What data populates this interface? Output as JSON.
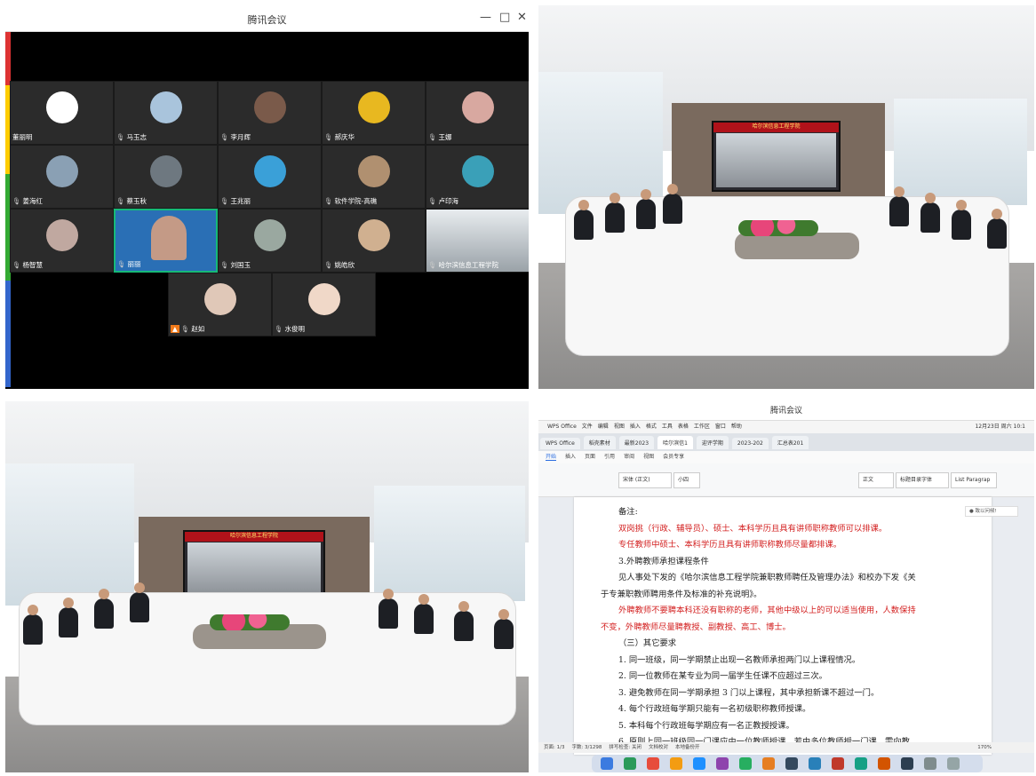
{
  "meeting": {
    "title": "腾讯会议",
    "controls": {
      "minimize": "—",
      "maximize": "□",
      "close": "✕"
    },
    "participants": [
      {
        "name": "董丽明",
        "mic": false,
        "avatar_color": "#ffffff"
      },
      {
        "name": "马玉志",
        "mic": true,
        "avatar_color": "#a9c4dc"
      },
      {
        "name": "李月辉",
        "mic": true,
        "avatar_color": "#7a5a4a"
      },
      {
        "name": "郝庆华",
        "mic": true,
        "avatar_color": "#e8b820"
      },
      {
        "name": "王娜",
        "mic": true,
        "avatar_color": "#d8a8a0"
      },
      {
        "name": "姜海红",
        "mic": true,
        "avatar_color": "#8aa0b4"
      },
      {
        "name": "蔡玉秋",
        "mic": true,
        "avatar_color": "#6e7880"
      },
      {
        "name": "王兆丽",
        "mic": true,
        "avatar_color": "#3aa0d8"
      },
      {
        "name": "软件学院-高礁",
        "mic": true,
        "avatar_color": "#b09070"
      },
      {
        "name": "卢印海",
        "mic": true,
        "avatar_color": "#3aa0b8"
      },
      {
        "name": "杨智慧",
        "mic": true,
        "avatar_color": "#c0a8a0"
      },
      {
        "name": "丽丽",
        "mic": true,
        "avatar_color": "#c49a86",
        "active": true
      },
      {
        "name": "刘国玉",
        "mic": true,
        "avatar_color": "#9aa8a0"
      },
      {
        "name": "姚皓欣",
        "mic": true,
        "avatar_color": "#d0b090"
      },
      {
        "name": "哈尔滨信息工程学院",
        "mic": true,
        "avatar_color": "#b8c0c4",
        "room": true
      },
      {
        "name": "赵如",
        "mic": true,
        "avatar_color": "#e0c8b8",
        "host": true
      },
      {
        "name": "水俊明",
        "mic": true,
        "avatar_color": "#f0d8c8"
      }
    ]
  },
  "photo_room_1": {
    "screen_banner": "哈尔滨信息工程学院"
  },
  "photo_room_2": {
    "screen_banner": "哈尔滨信息工程学院"
  },
  "wps": {
    "window_title": "腾讯会议",
    "menubar": [
      "WPS Office",
      "文件",
      "编辑",
      "视图",
      "插入",
      "格式",
      "工具",
      "表格",
      "工作区",
      "窗口",
      "帮助"
    ],
    "clock": "12月23日 周六 10:1",
    "tabs": [
      "WPS Office",
      "稻壳素材",
      "最新2023",
      "哈尔滨信1",
      "迎评学期",
      "2023-202",
      "汇总表201"
    ],
    "active_tab": 3,
    "ribbon_tabs": [
      "开始",
      "插入",
      "页面",
      "引用",
      "审阅",
      "视图",
      "会员专享"
    ],
    "active_ribbon_tab": 0,
    "font_name": "宋体 (正文)",
    "font_size": "小四",
    "styles": [
      "正文",
      "标题目录字体",
      "List Paragrap"
    ],
    "comment_box": "● 致以问候!",
    "doc_lines": [
      {
        "text": "备注:",
        "red": false,
        "indent": 0
      },
      {
        "text": "双岗挑（行政、辅导员）、硕士、本科学历且具有讲师职称教师可以排课。",
        "red": true,
        "indent": 0
      },
      {
        "text": "专任教师中硕士、本科学历且具有讲师职称教师尽量都排课。",
        "red": true,
        "indent": 0
      },
      {
        "text": "3.外聘教师承担课程条件",
        "red": false,
        "indent": 0
      },
      {
        "text": "见人事处下发的《哈尔滨信息工程学院兼职教师聘任及管理办法》和校办下发《关",
        "red": false,
        "indent": 0
      },
      {
        "text": "于专兼职教师聘用条件及标准的补充说明》。",
        "red": false,
        "indent": -1
      },
      {
        "text": "外聘教师不要聘本科还没有职称的老师，其他中级以上的可以适当使用，人数保持",
        "red": true,
        "indent": 0
      },
      {
        "text": "不变，外聘教师尽量聘教授、副教授、高工、博士。",
        "red": true,
        "indent": -1
      },
      {
        "text": "（三）其它要求",
        "red": false,
        "indent": 0
      },
      {
        "text": "1. 同一班级，同一学期禁止出现一名教师承担两门以上课程情况。",
        "red": false,
        "indent": 0
      },
      {
        "text": "2. 同一位教师在某专业为同一届学生任课不应超过三次。",
        "red": false,
        "indent": 0
      },
      {
        "text": "3. 避免教师在同一学期承担 3 门以上课程，其中承担新课不超过一门。",
        "red": false,
        "indent": 0
      },
      {
        "text": "4. 每个行政班每学期只能有一名初级职称教师授课。",
        "red": false,
        "indent": 0
      },
      {
        "text": "5. 本科每个行政班每学期应有一名正教授授课。",
        "red": false,
        "indent": 0
      },
      {
        "text": "6. 原则上同一班级同一门课应由一位教师授课，若由多位教师授一门课，需向教",
        "red": false,
        "indent": 0
      }
    ],
    "status": [
      "页面: 1/3",
      "字数: 3/1298",
      "拼写检查: 关闭",
      "文档校对",
      "本地备份开"
    ],
    "zoom": "170%"
  }
}
